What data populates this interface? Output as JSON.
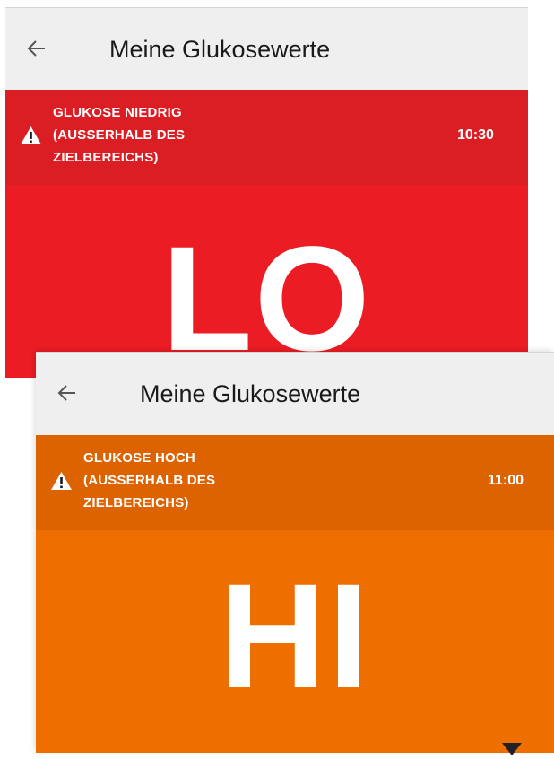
{
  "screens": [
    {
      "title": "Meine Glukosewerte",
      "alert_lines": [
        "GLUKOSE NIEDRIG",
        "(AUSSERHALB DES",
        "ZIELBEREICHS)"
      ],
      "time": "10:30",
      "value": "LO",
      "colors": {
        "band": "#db1d24",
        "value_bg": "#ec1c24"
      },
      "icons": {
        "back": "back-arrow-icon",
        "alert": "warning-triangle-icon"
      }
    },
    {
      "title": "Meine Glukosewerte",
      "alert_lines": [
        "GLUKOSE HOCH",
        "(AUSSERHALB DES",
        "ZIELBEREICHS)"
      ],
      "time": "11:00",
      "value": "HI",
      "colors": {
        "band": "#dd6200",
        "value_bg": "#ee6e00"
      },
      "icons": {
        "back": "back-arrow-icon",
        "alert": "warning-triangle-icon"
      }
    }
  ]
}
